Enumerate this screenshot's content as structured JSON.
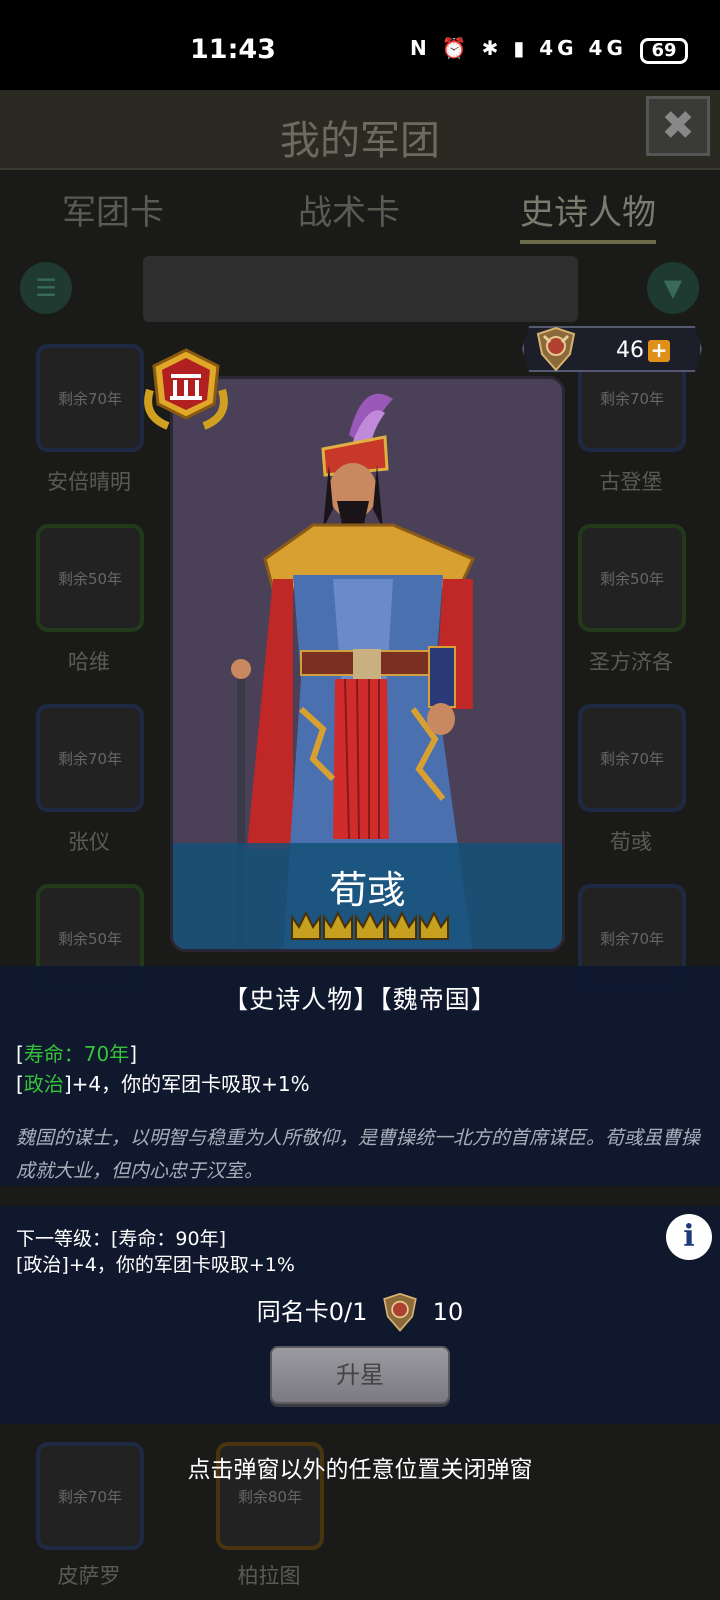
{
  "status_bar": {
    "time": "11:43",
    "icons": "N ⏰ ✱ ▮ 4G 4G",
    "battery": "69"
  },
  "background": {
    "title": "我的军团",
    "close": "✖",
    "tabs": [
      "军团卡",
      "战术卡",
      "史诗人物"
    ],
    "cards_left": [
      {
        "rem": "剩余70年",
        "name": "安倍晴明"
      },
      {
        "rem": "剩余50年",
        "name": "哈维"
      },
      {
        "rem": "剩余70年",
        "name": "张仪"
      },
      {
        "rem": "剩余50年",
        "name": ""
      },
      {
        "rem": "剩余70年",
        "name": "皮萨罗"
      }
    ],
    "cards_right": [
      {
        "rem": "剩余70年",
        "name": "古登堡"
      },
      {
        "rem": "剩余50年",
        "name": "圣方济各"
      },
      {
        "rem": "剩余70年",
        "name": "荀彧"
      },
      {
        "rem": "剩余70年",
        "name": ""
      }
    ],
    "bottom_mid": {
      "rem": "剩余80年",
      "name": "柏拉图"
    }
  },
  "currency": {
    "amount": "46",
    "plus": "+"
  },
  "hero": {
    "name": "荀彧",
    "stars": 5,
    "colors": {
      "band": "#14507a",
      "crown": "#c8a020"
    }
  },
  "info": {
    "header": "【史诗人物】【魏帝国】",
    "lifespan_open": "[",
    "lifespan": "寿命：70年",
    "lifespan_close": "]",
    "politics_tag": "政治",
    "politics_effect": "+4，你的军团卡吸取+1%",
    "description": "魏国的谋士，以明智与稳重为人所敬仰，是曹操统一北方的首席谋臣。荀彧虽曹操成就大业，但内心忠于汉室。"
  },
  "next_level": {
    "line1": "下一等级：[寿命：90年]",
    "line2": "[政治]+4，你的军团卡吸取+1%",
    "same_card_label": "同名卡0/1",
    "same_card_cost": "10",
    "upgrade_button": "升星",
    "info_icon": "i"
  },
  "close_hint": "点击弹窗以外的任意位置关闭弹窗"
}
